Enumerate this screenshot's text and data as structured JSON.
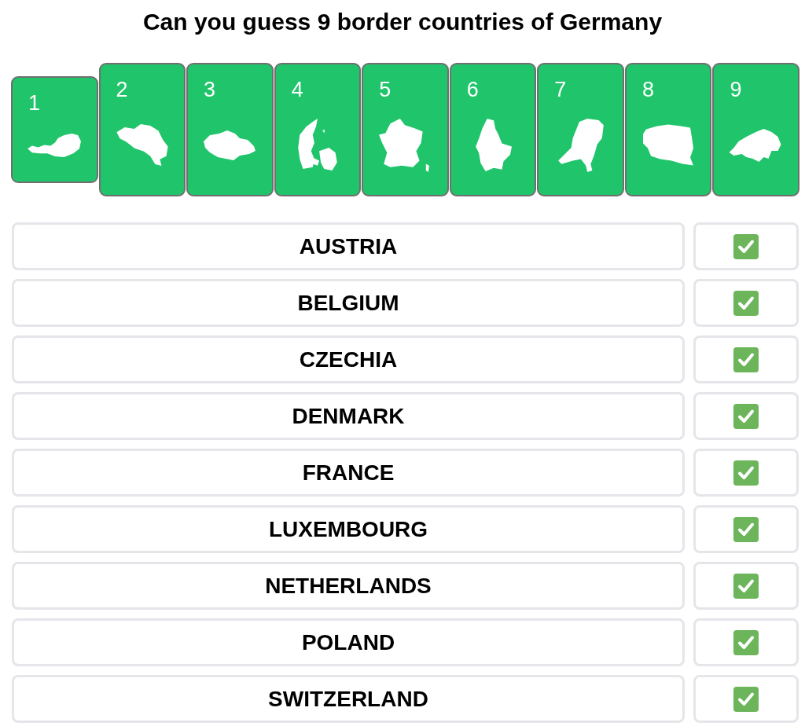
{
  "title": "Can you guess 9 border countries of Germany",
  "cards": [
    {
      "number": "1",
      "selected": true
    },
    {
      "number": "2",
      "selected": false
    },
    {
      "number": "3",
      "selected": false
    },
    {
      "number": "4",
      "selected": false
    },
    {
      "number": "5",
      "selected": false
    },
    {
      "number": "6",
      "selected": false
    },
    {
      "number": "7",
      "selected": false
    },
    {
      "number": "8",
      "selected": false
    },
    {
      "number": "9",
      "selected": false
    }
  ],
  "answers": [
    {
      "name": "AUSTRIA",
      "checked": true
    },
    {
      "name": "BELGIUM",
      "checked": true
    },
    {
      "name": "CZECHIA",
      "checked": true
    },
    {
      "name": "DENMARK",
      "checked": true
    },
    {
      "name": "FRANCE",
      "checked": true
    },
    {
      "name": "LUXEMBOURG",
      "checked": true
    },
    {
      "name": "NETHERLANDS",
      "checked": true
    },
    {
      "name": "POLAND",
      "checked": true
    },
    {
      "name": "SWITZERLAND",
      "checked": true
    }
  ]
}
